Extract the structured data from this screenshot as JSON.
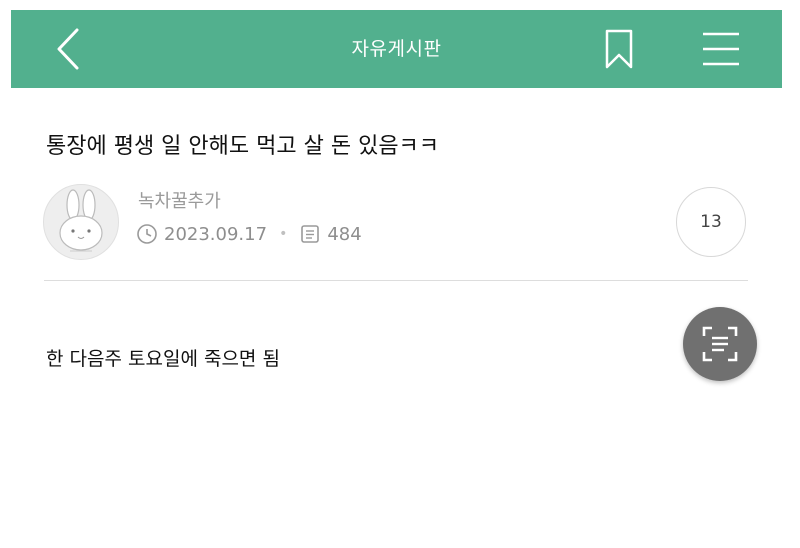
{
  "header": {
    "board_title": "자유게시판",
    "icons": [
      "back-arrow-icon",
      "bookmark-icon",
      "menu-icon"
    ],
    "background_color": "#52b08e"
  },
  "post": {
    "title": "통장에 평생 일 안해도 먹고 살 돈 있음ㅋㅋ",
    "author": "녹차꿀추가",
    "date": "2023.09.17",
    "views": "484",
    "comment_count": "13",
    "body": "한 다음주 토요일에 죽으면 됨"
  },
  "floating_button": {
    "icon": "text-scan-icon"
  }
}
